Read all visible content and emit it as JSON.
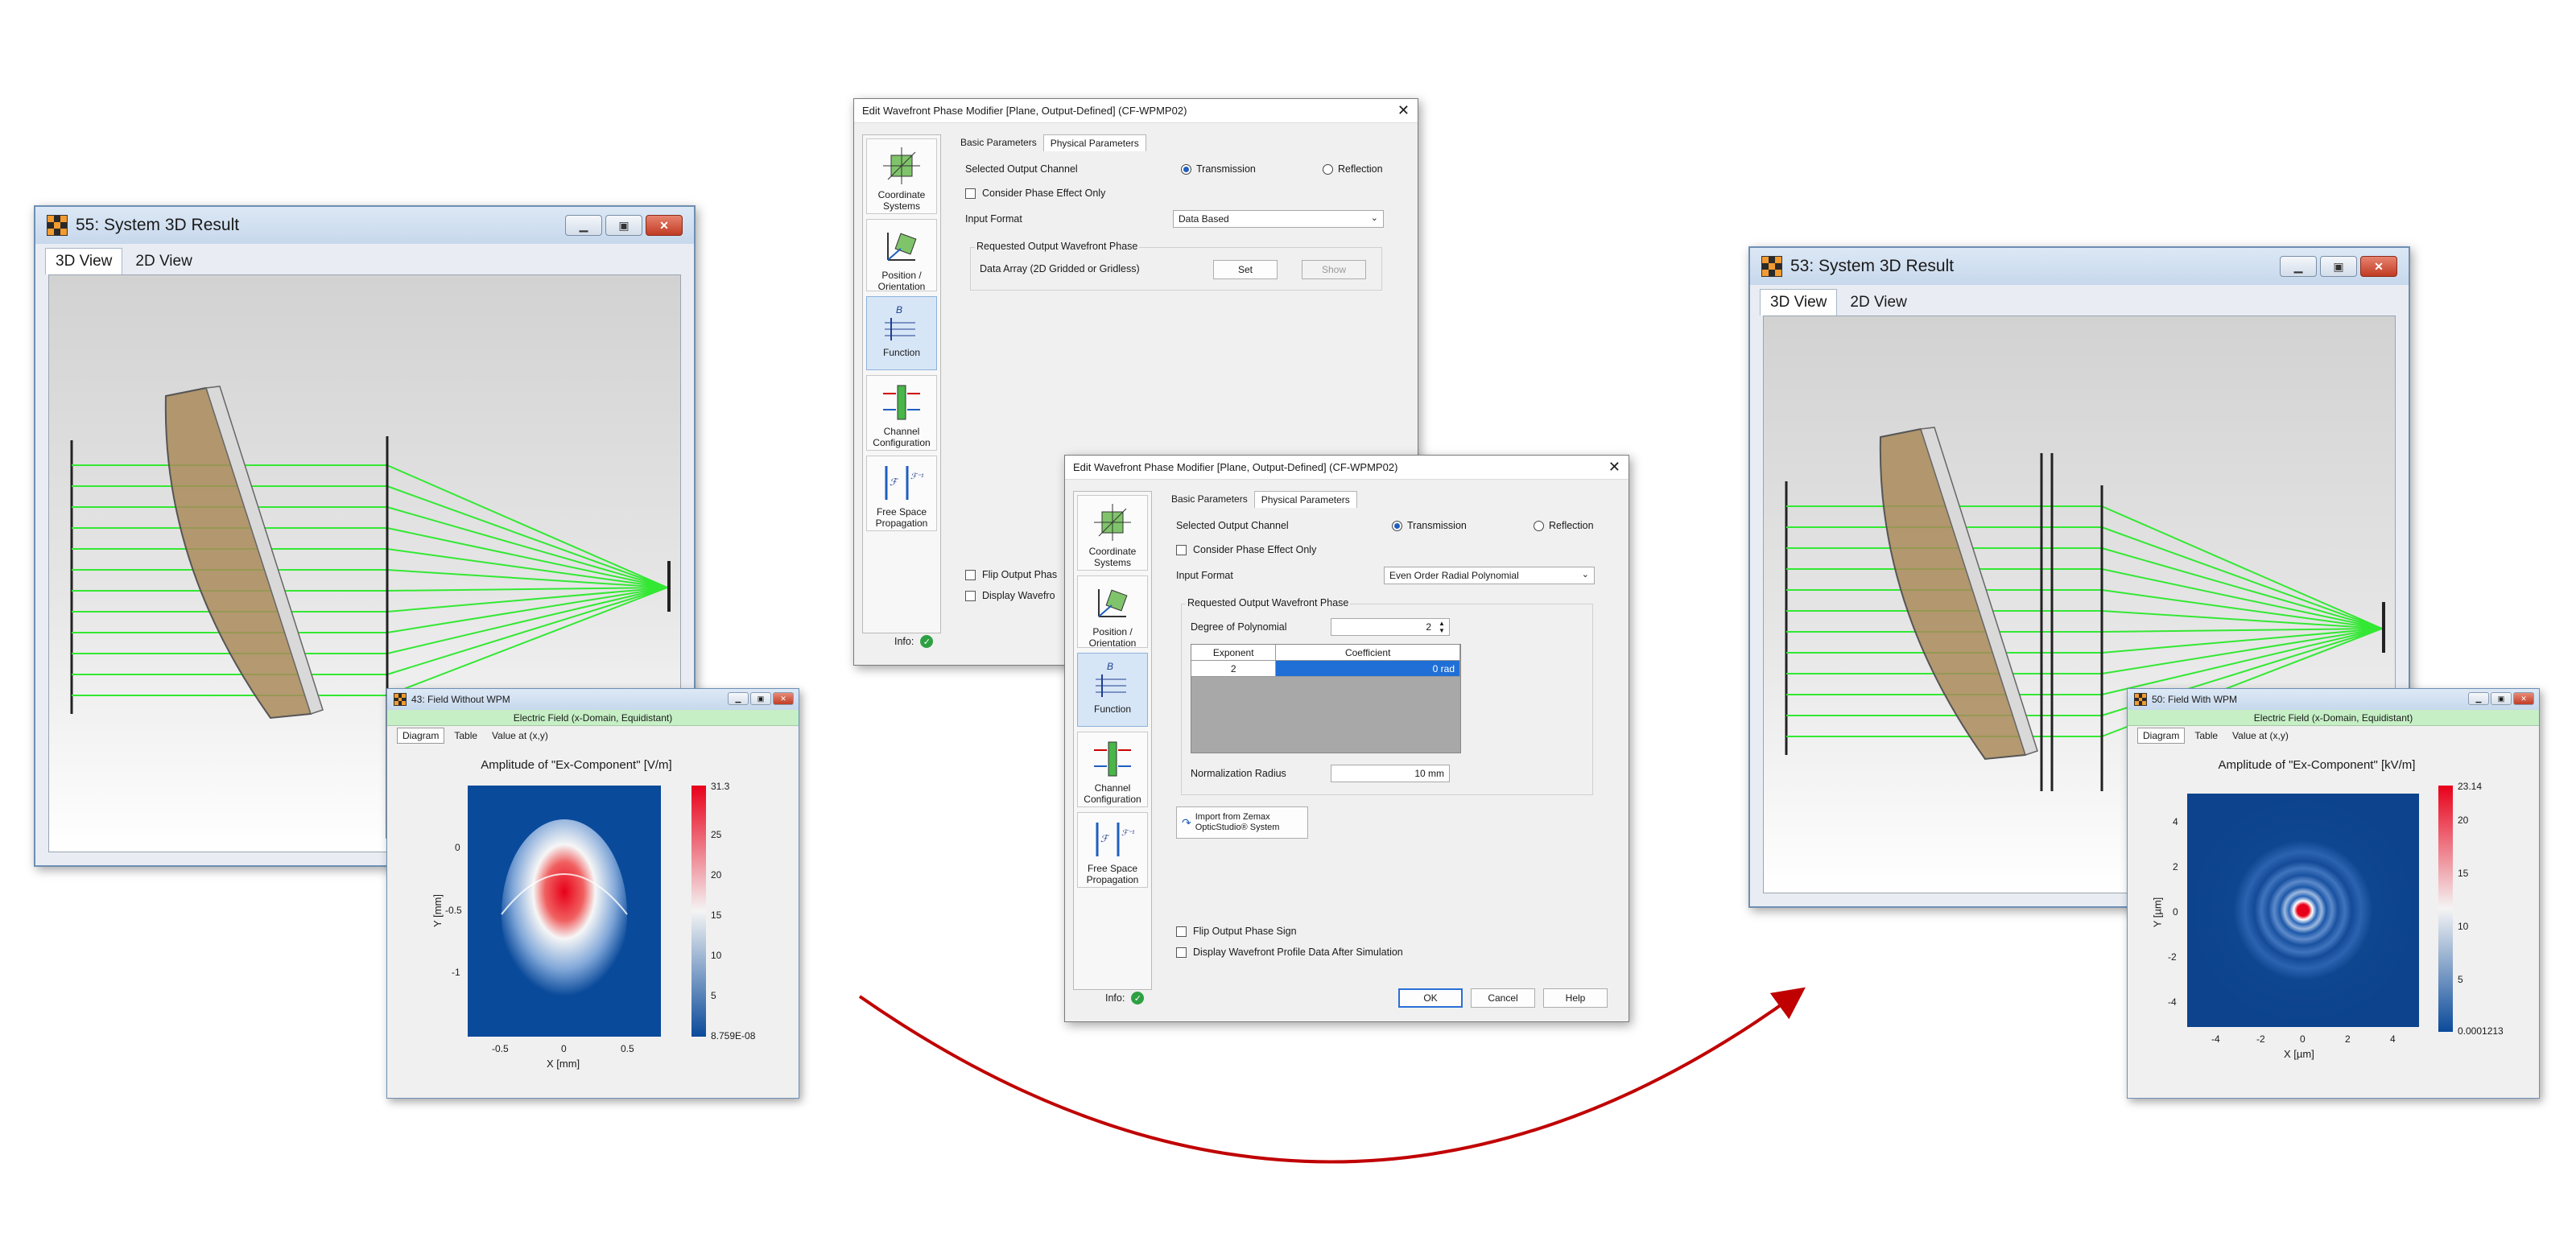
{
  "left_window": {
    "title": "55: System 3D Result",
    "tabs": [
      "3D View",
      "2D View"
    ],
    "buttons": [
      "minimize",
      "restore",
      "close"
    ]
  },
  "right_window": {
    "title": "53: System 3D Result",
    "tabs": [
      "3D View",
      "2D View"
    ],
    "buttons": [
      "minimize",
      "restore",
      "close"
    ]
  },
  "field_left": {
    "title": "43: Field Without WPM",
    "subtitle": "Electric Field (x-Domain, Equidistant)",
    "tabs": [
      "Diagram",
      "Table",
      "Value at (x,y)"
    ],
    "plot_title": "Amplitude of \"Ex-Component\"  [V/m]",
    "xlabel": "X [mm]",
    "ylabel": "Y [mm]",
    "xticks": [
      "-0.5",
      "0",
      "0.5"
    ],
    "yticks": [
      "0",
      "-0.5",
      "-1"
    ],
    "colorbar_ticks": [
      "31.3",
      "25",
      "20",
      "15",
      "10",
      "5",
      "8.759E-08"
    ]
  },
  "field_right": {
    "title": "50: Field With WPM",
    "subtitle": "Electric Field (x-Domain, Equidistant)",
    "tabs": [
      "Diagram",
      "Table",
      "Value at (x,y)"
    ],
    "plot_title": "Amplitude of \"Ex-Component\"  [kV/m]",
    "xlabel": "X [µm]",
    "ylabel": "Y [µm]",
    "xticks": [
      "-4",
      "-2",
      "0",
      "2",
      "4"
    ],
    "yticks": [
      "4",
      "2",
      "0",
      "-2",
      "-4"
    ],
    "colorbar_ticks": [
      "23.14",
      "20",
      "15",
      "10",
      "5",
      "0.0001213"
    ]
  },
  "dialog_back": {
    "title": "Edit Wavefront Phase Modifier [Plane, Output-Defined] (CF-WPMP02)",
    "tabs": [
      "Basic Parameters",
      "Physical Parameters"
    ],
    "selected_output_channel_label": "Selected Output Channel",
    "transmission": "Transmission",
    "reflection": "Reflection",
    "consider_phase_label": "Consider Phase Effect Only",
    "input_format_label": "Input Format",
    "input_format_value": "Data Based",
    "group_label": "Requested Output Wavefront Phase",
    "data_array_label": "Data Array (2D Gridded or Gridless)",
    "set_button": "Set",
    "show_button": "Show",
    "flip_label": "Flip Output Phas",
    "display_label": "Display Wavefro",
    "info_label": "Info:"
  },
  "dialog_front": {
    "title": "Edit Wavefront Phase Modifier [Plane, Output-Defined] (CF-WPMP02)",
    "tabs": [
      "Basic Parameters",
      "Physical Parameters"
    ],
    "selected_output_channel_label": "Selected Output Channel",
    "transmission": "Transmission",
    "reflection": "Reflection",
    "consider_phase_label": "Consider Phase Effect Only",
    "input_format_label": "Input Format",
    "input_format_value": "Even Order Radial Polynomial",
    "group_label": "Requested Output Wavefront Phase",
    "degree_label": "Degree of Polynomial",
    "degree_value": "2",
    "table_headers": [
      "Exponent",
      "Coefficient"
    ],
    "table_rows": [
      [
        "2",
        "0 rad"
      ]
    ],
    "norm_radius_label": "Normalization Radius",
    "norm_radius_value": "10 mm",
    "import_button": "Import from Zemax OpticStudio® System",
    "import_line1": "Import from Zemax",
    "import_line2": "OpticStudio® System",
    "flip_label": "Flip Output Phase Sign",
    "display_label": "Display Wavefront Profile Data After Simulation",
    "info_label": "Info:",
    "ok_button": "OK",
    "cancel_button": "Cancel",
    "help_button": "Help"
  },
  "sidebar": {
    "items": [
      {
        "line1": "Coordinate",
        "line2": "Systems",
        "icon": "coordinate-systems-icon"
      },
      {
        "line1": "Position /",
        "line2": "Orientation",
        "icon": "position-orientation-icon"
      },
      {
        "line1": "Function",
        "line2": "",
        "icon": "function-icon"
      },
      {
        "line1": "Channel",
        "line2": "Configuration",
        "icon": "channel-configuration-icon"
      },
      {
        "line1": "Free Space",
        "line2": "Propagation",
        "icon": "free-space-propagation-icon"
      }
    ]
  },
  "colors": {
    "ray_green": "#33e833",
    "arrow_red": "#c00000",
    "accent_blue": "#1f5fbf",
    "green_banner": "#c6efc6"
  }
}
